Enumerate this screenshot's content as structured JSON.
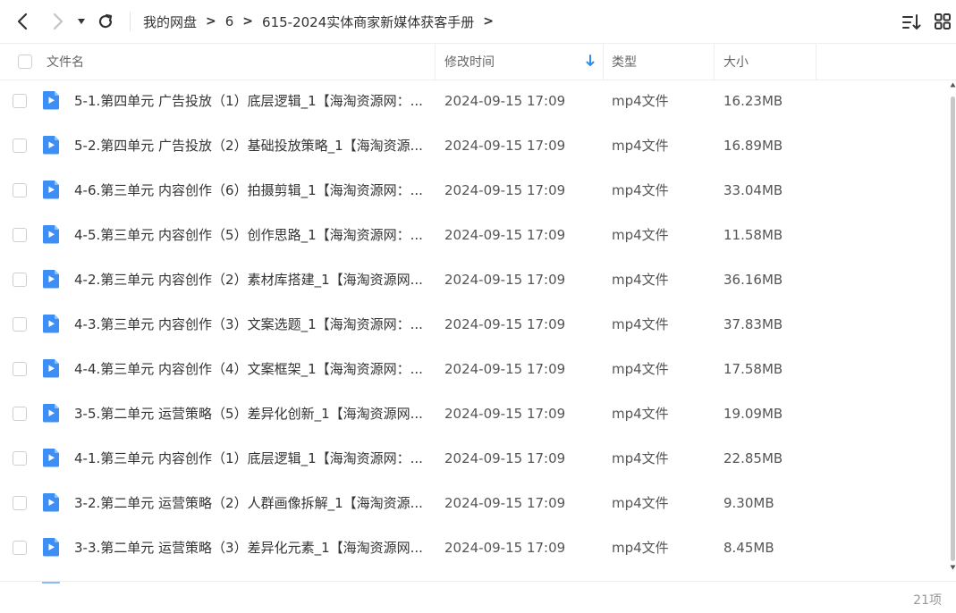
{
  "toolbar": {
    "breadcrumb": [
      "我的网盘",
      "6",
      "615-2024实体商家新媒体获客手册"
    ]
  },
  "columns": {
    "name": "文件名",
    "modified": "修改时间",
    "type": "类型",
    "size": "大小"
  },
  "files": [
    {
      "name": "5-1.第四单元 广告投放（1）底层逻辑_1【海淘资源网：...",
      "date": "2024-09-15 17:09",
      "type": "mp4文件",
      "size": "16.23MB"
    },
    {
      "name": "5-2.第四单元 广告投放（2）基础投放策略_1【海淘资源...",
      "date": "2024-09-15 17:09",
      "type": "mp4文件",
      "size": "16.89MB"
    },
    {
      "name": "4-6.第三单元 内容创作（6）拍摄剪辑_1【海淘资源网：...",
      "date": "2024-09-15 17:09",
      "type": "mp4文件",
      "size": "33.04MB"
    },
    {
      "name": "4-5.第三单元 内容创作（5）创作思路_1【海淘资源网：...",
      "date": "2024-09-15 17:09",
      "type": "mp4文件",
      "size": "11.58MB"
    },
    {
      "name": "4-2.第三单元 内容创作（2）素材库搭建_1【海淘资源网...",
      "date": "2024-09-15 17:09",
      "type": "mp4文件",
      "size": "36.16MB"
    },
    {
      "name": "4-3.第三单元 内容创作（3）文案选题_1【海淘资源网：...",
      "date": "2024-09-15 17:09",
      "type": "mp4文件",
      "size": "37.83MB"
    },
    {
      "name": "4-4.第三单元 内容创作（4）文案框架_1【海淘资源网：...",
      "date": "2024-09-15 17:09",
      "type": "mp4文件",
      "size": "17.58MB"
    },
    {
      "name": "3-5.第二单元 运营策略（5）差异化创新_1【海淘资源网...",
      "date": "2024-09-15 17:09",
      "type": "mp4文件",
      "size": "19.09MB"
    },
    {
      "name": "4-1.第三单元 内容创作（1）底层逻辑_1【海淘资源网：...",
      "date": "2024-09-15 17:09",
      "type": "mp4文件",
      "size": "22.85MB"
    },
    {
      "name": "3-2.第二单元 运营策略（2）人群画像拆解_1【海淘资源...",
      "date": "2024-09-15 17:09",
      "type": "mp4文件",
      "size": "9.30MB"
    },
    {
      "name": "3-3.第二单元 运营策略（3）差异化元素_1【海淘资源网...",
      "date": "2024-09-15 17:09",
      "type": "mp4文件",
      "size": "8.45MB"
    }
  ],
  "footer": {
    "count": "21项"
  },
  "colors": {
    "accent": "#2f8cf0",
    "icon_blue": "#3d8ff5"
  }
}
